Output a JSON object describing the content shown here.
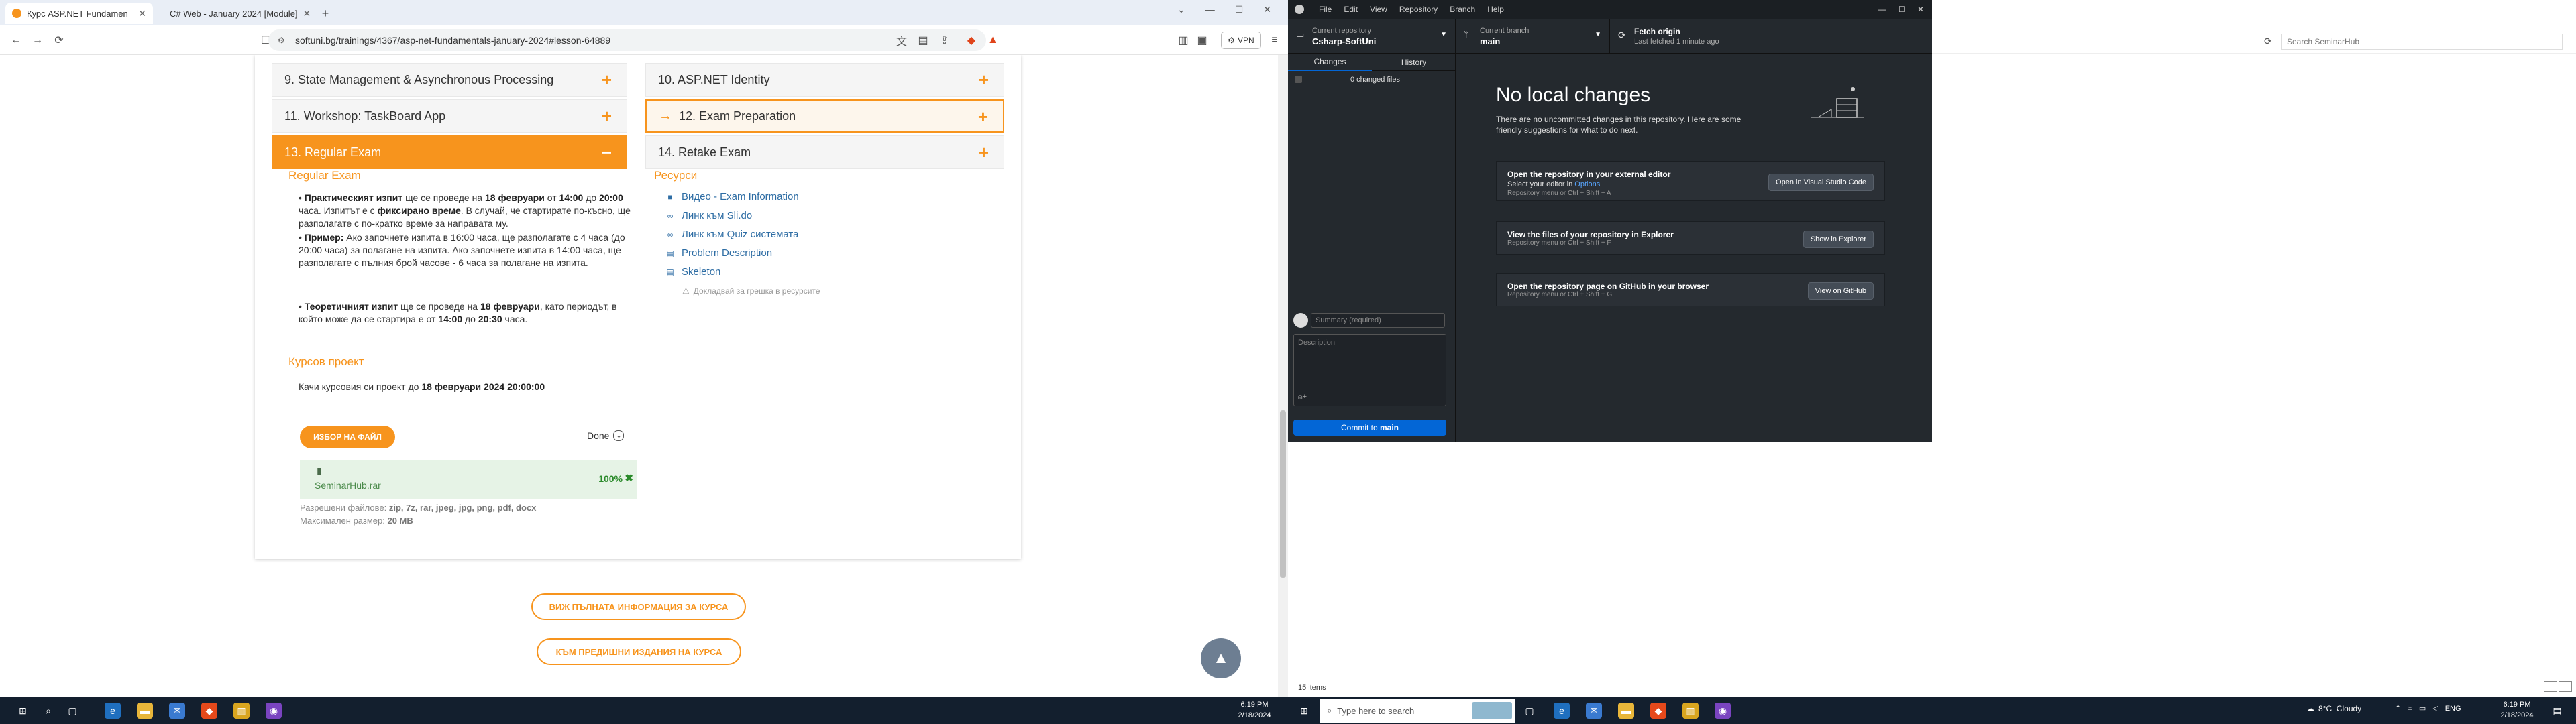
{
  "browser": {
    "tabs": [
      {
        "label": "Курс ASP.NET Fundamentals - ",
        "active": true
      },
      {
        "label": "C# Web - January 2024 [Module]",
        "active": false
      }
    ],
    "url": "softuni.bg/trainings/4367/asp-net-fundamentals-january-2024#lesson-64889",
    "vpn_label": "VPN",
    "window_controls": {
      "minimize": "—",
      "maximize": "☐",
      "close": "✕"
    }
  },
  "lessons": [
    {
      "label": "9.  State Management & Asynchronous Processing",
      "state": "normal"
    },
    {
      "label": "10.  ASP.NET Identity",
      "state": "normal"
    },
    {
      "label": "11.  Workshop: TaskBoard App",
      "state": "normal"
    },
    {
      "label": "12.  Exam Preparation",
      "state": "highlighted"
    },
    {
      "label": "13.  Regular Exam",
      "state": "active"
    },
    {
      "label": "14.  Retake Exam",
      "state": "normal"
    }
  ],
  "icons": {
    "plus": "+",
    "minus": "−",
    "arrow": "→"
  },
  "regular_exam": {
    "title": "Regular Exam",
    "p1_a": "• ",
    "p1_b": "Практическият изпит",
    "p1_c": " ще се проведе на ",
    "p1_d": "18 февруари",
    "p1_e": " от ",
    "p1_f": "14:00",
    "p1_g": " до ",
    "p1_h": "20:00",
    "p1_i": " часа. Изпитът е с ",
    "p1_j": "фиксирано време",
    "p1_k": ". В случай, че стартирате по-късно, ще разполагате с по-кратко време за направата му.",
    "p2_a": "• ",
    "p2_b": "Пример:",
    "p2_c": " Ако започнете изпита в 16:00 часа, ще разполагате с 4 часа (до 20:00 часа) за полагане на изпита. Ако започнете изпита в 14:00 часа, ще разполагате с пълния брой часове - 6 часа за полагане на изпита.",
    "p3_a": "• ",
    "p3_b": "Теоретичният изпит",
    "p3_c": " ще се проведе на ",
    "p3_d": "18 февруари",
    "p3_e": ", като периодът, в който може да се стартира е от ",
    "p3_f": "14:00",
    "p3_g": " до ",
    "p3_h": "20:30",
    "p3_i": " часа."
  },
  "resources": {
    "title": "Ресурси",
    "items": [
      {
        "label": "Видео - Exam Information",
        "icon": "video-icon"
      },
      {
        "label": "Линк към Sli.do",
        "icon": "link-icon"
      },
      {
        "label": "Линк към Quiz системата",
        "icon": "link-icon"
      },
      {
        "label": "Problem Description",
        "icon": "document-icon"
      },
      {
        "label": "Skeleton",
        "icon": "document-icon"
      }
    ],
    "report_label": "Докладвай за грешка в ресурсите"
  },
  "course_project": {
    "title": "Курсов проект",
    "deadline_prefix": "Качи курсовия си проект до ",
    "deadline": "18 февруари 2024 20:00:00",
    "upload_button": "ИЗБОР НА ФАЙЛ",
    "done_label": "Done",
    "file_name": "SeminarHub.rar",
    "file_progress": "100%",
    "allowed_label": "Разрешени файлове: ",
    "allowed_value": "zip, 7z, rar, jpeg, jpg, png, pdf, docx",
    "max_label": "Максимален размер: ",
    "max_value": "20 MB"
  },
  "bottom_buttons": {
    "full_info": "ВИЖ ПЪЛНАТА ИНФОРМАЦИЯ ЗА КУРСА",
    "previous": "КЪМ ПРЕДИШНИ ИЗДАНИЯ НА КУРСА"
  },
  "taskbar_left": {
    "time": "6:19 PM",
    "date": "2/18/2024"
  },
  "taskbar_right": {
    "search_placeholder": "Type here to search",
    "weather": "8°C  Cloudy",
    "lang": "ENG",
    "time": "6:19 PM",
    "date": "2/18/2024"
  },
  "explorer": {
    "search_placeholder": "Search SeminarHub",
    "status": "15 items"
  },
  "github": {
    "menu": [
      "File",
      "Edit",
      "View",
      "Repository",
      "Branch",
      "Help"
    ],
    "current_repo_label": "Current repository",
    "current_repo": "Csharp-SoftUni",
    "current_branch_label": "Current branch",
    "current_branch": "main",
    "fetch_label": "Fetch origin",
    "fetch_sub": "Last fetched 1 minute ago",
    "tabs": [
      "Changes",
      "History"
    ],
    "changed_files": "0 changed files",
    "summary_placeholder": "Summary (required)",
    "description_placeholder": "Description",
    "commit_prefix": "Commit to ",
    "commit_branch": "main",
    "no_changes_title": "No local changes",
    "no_changes_text": "There are no uncommitted changes in this repository. Here are some friendly suggestions for what to do next.",
    "actions": [
      {
        "title": "Open the repository in your external editor",
        "line2_prefix": "Select your editor in ",
        "line2_link": "Options",
        "shortcut": "Repository menu or  Ctrl + Shift + A",
        "button": "Open in Visual Studio Code"
      },
      {
        "title": "View the files of your repository in Explorer",
        "line2_prefix": "",
        "line2_link": "",
        "shortcut": "Repository menu or  Ctrl + Shift + F",
        "button": "Show in Explorer"
      },
      {
        "title": "Open the repository page on GitHub in your browser",
        "line2_prefix": "",
        "line2_link": "",
        "shortcut": "Repository menu or  Ctrl + Shift + G",
        "button": "View on GitHub"
      }
    ]
  }
}
